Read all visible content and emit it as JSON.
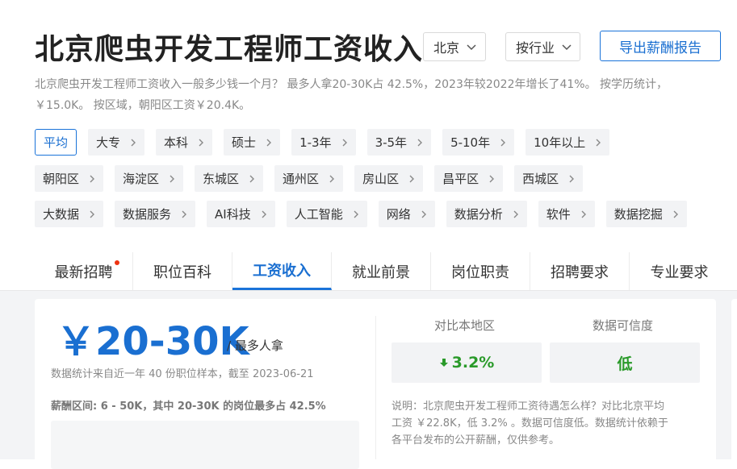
{
  "header": {
    "title": "北京爬虫开发工程师工资收入",
    "city_select": "北京",
    "industry_select": "按行业",
    "export_label": "导出薪酬报告"
  },
  "description": {
    "line1": "北京爬虫开发工程师工资收入一般多少钱一个月？ 最多人拿20-30K占 42.5%，2023年较2022年增长了41%。 按学历统计，",
    "line2": "￥15.0K。 按区域，朝阳区工资￥20.4K。"
  },
  "filters": {
    "education_exp": [
      {
        "label": "平均",
        "active": true
      },
      {
        "label": "大专"
      },
      {
        "label": "本科"
      },
      {
        "label": "硕士"
      },
      {
        "label": "1-3年"
      },
      {
        "label": "3-5年"
      },
      {
        "label": "5-10年"
      },
      {
        "label": "10年以上"
      }
    ],
    "districts": [
      "朝阳区",
      "海淀区",
      "东城区",
      "通州区",
      "房山区",
      "昌平区",
      "西城区"
    ],
    "industries": [
      "大数据",
      "数据服务",
      "AI科技",
      "人工智能",
      "网络",
      "数据分析",
      "软件",
      "数据挖掘"
    ]
  },
  "tabs": [
    {
      "label": "最新招聘",
      "badge": true
    },
    {
      "label": "职位百科"
    },
    {
      "label": "工资收入",
      "active": true
    },
    {
      "label": "就业前景"
    },
    {
      "label": "岗位职责"
    },
    {
      "label": "招聘要求"
    },
    {
      "label": "专业要求"
    }
  ],
  "salary": {
    "headline": "￥20-30K",
    "headline_suffix": "/ 最多人拿",
    "stats_note": "数据统计来自近一年 40 份职位样本，截至 2023-06-21",
    "range_note": "薪酬区间: 6 - 50K，其中 20-30K 的岗位最多占 42.5%"
  },
  "comparison": {
    "region_title": "对比本地区",
    "region_value": "3.2%",
    "reliability_title": "数据可信度",
    "reliability_value": "低",
    "explain_line1": "说明：北京爬虫开发工程师工资待遇怎么样？对比北京平均",
    "explain_line2": "工资 ￥22.8K，低 3.2% 。数据可信度低。数据统计依赖于",
    "explain_line3": "各平台发布的公开薪酬，仅供参考。"
  },
  "colors": {
    "accent": "#1a73d9",
    "positive_down": "#2a9a2a",
    "badge": "#ee3311"
  }
}
